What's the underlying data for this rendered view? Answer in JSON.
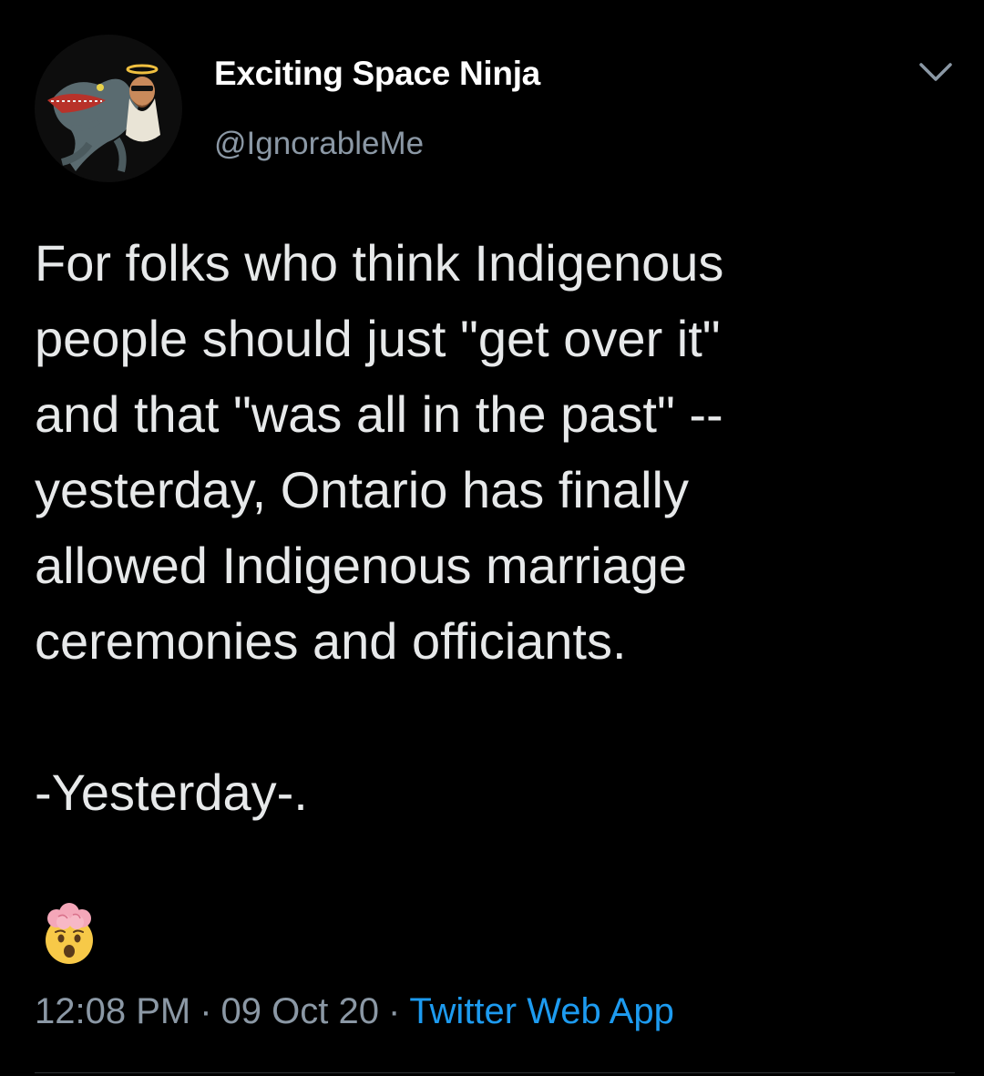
{
  "author": {
    "display_name": "Exciting Space Ninja",
    "handle": "@IgnorableMe",
    "avatar_icon": "avatar-image"
  },
  "menu": {
    "icon": "chevron-down-icon"
  },
  "tweet": {
    "lines": [
      "For folks who think Indigenous",
      "people should just \"get over it\"",
      "and that \"was all in the past\" --",
      "yesterday, Ontario has finally",
      "allowed Indigenous marriage",
      "ceremonies and officiants.",
      "",
      "-Yesterday-."
    ],
    "emoji": "exploding-head-emoji"
  },
  "meta": {
    "time": "12:08 PM",
    "date": "09 Oct 20",
    "separator": "·",
    "source": "Twitter Web App"
  },
  "colors": {
    "background": "#000000",
    "primary_text": "#e7e9ea",
    "secondary_text": "#8b98a5",
    "link": "#1d9bf0"
  }
}
